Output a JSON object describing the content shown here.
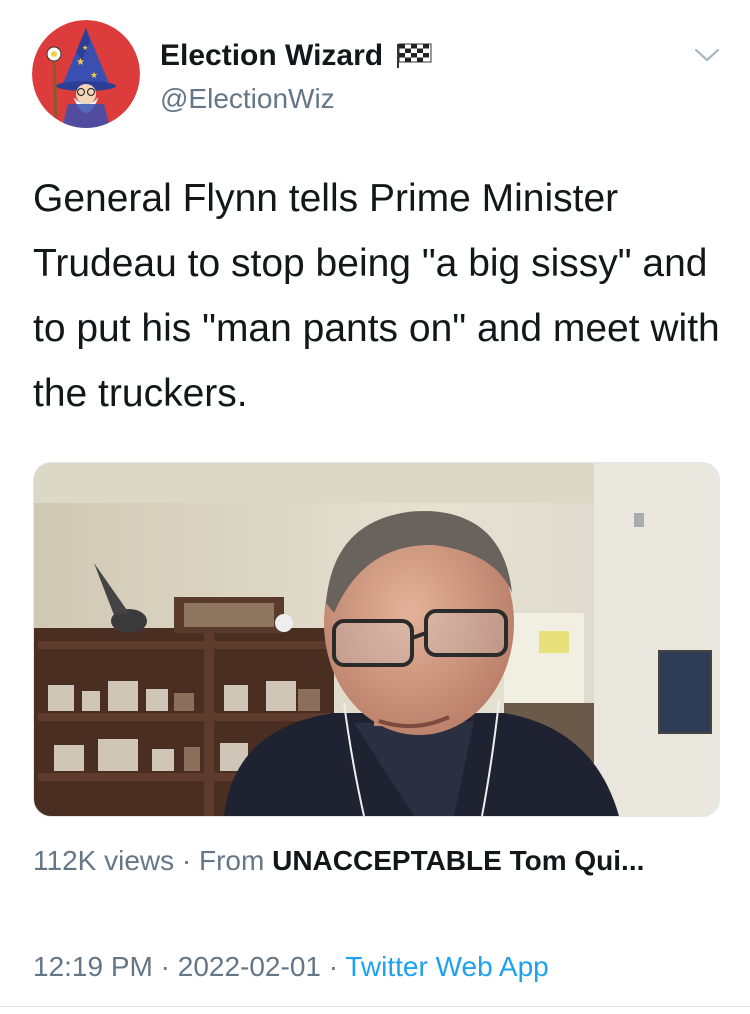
{
  "user": {
    "display_name": "Election Wizard",
    "handle": "@ElectionWiz"
  },
  "tweet": {
    "text": "General Flynn tells Prime Minister Trudeau to stop being \"a big sissy\" and to put his \"man pants on\" and meet with the truckers."
  },
  "video": {
    "views": "112K views",
    "from_label": "From",
    "source": "UNACCEPTABLE Tom Qui..."
  },
  "footer": {
    "time": "12:19 PM",
    "date": "2022-02-01",
    "app": "Twitter Web App"
  },
  "colors": {
    "avatar_bg": "#dc3c3c",
    "link": "#1da1f2",
    "secondary_text": "#657786"
  },
  "icons": {
    "flag": "checkered-flag-icon",
    "chevron": "chevron-down-icon"
  }
}
